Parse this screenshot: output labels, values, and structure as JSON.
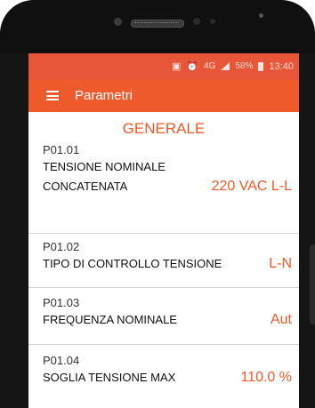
{
  "status_bar": {
    "network": "4G",
    "battery": "58%",
    "time": "13:40"
  },
  "app_bar": {
    "title": "Parametri"
  },
  "section": {
    "title": "GENERALE"
  },
  "params": [
    {
      "code": "P01.01",
      "name_line1": "TENSIONE NOMINALE",
      "name_line2": "CONCATENATA",
      "value": "220 VAC L-L"
    },
    {
      "code": "P01.02",
      "name": "TIPO DI CONTROLLO TENSIONE",
      "value": "L-N"
    },
    {
      "code": "P01.03",
      "name": "FREQUENZA NOMINALE",
      "value": "Aut"
    },
    {
      "code": "P01.04",
      "name": "SOGLIA TENSIONE MAX",
      "value": "110.0 %"
    }
  ],
  "colors": {
    "accent": "#ef5a2d",
    "status_bar": "#e8563a"
  }
}
